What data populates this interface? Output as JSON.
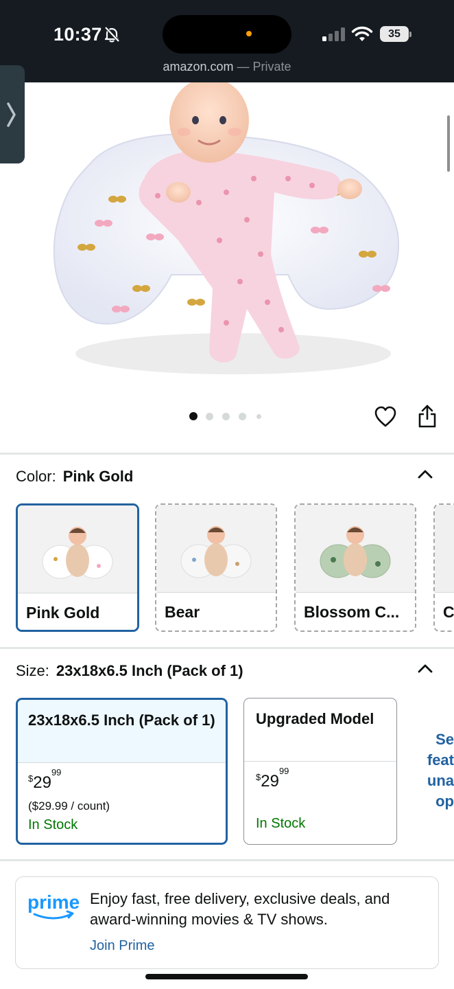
{
  "status_bar": {
    "time": "10:37",
    "battery": "35",
    "url_domain": "amazon.com",
    "url_suffix": " — Private"
  },
  "icons": {
    "bell_muted": "bell-slash-icon",
    "signal": "cellular-signal-icon",
    "wifi": "wifi-icon",
    "heart": "heart-icon",
    "share": "share-icon",
    "chevron": "chevron-up-icon",
    "side_tab": "chevron-right-icon"
  },
  "gallery": {
    "image_alt": "Baby lying on pink gold butterfly nursing pillow",
    "dot_count": 5,
    "active_dot": 0
  },
  "color_selector": {
    "label": "Color:",
    "selected": "Pink Gold",
    "options": [
      {
        "name": "Pink Gold"
      },
      {
        "name": "Bear"
      },
      {
        "name": "Blossom C..."
      },
      {
        "name": "C"
      }
    ]
  },
  "size_selector": {
    "label": "Size:",
    "selected": "23x18x6.5 Inch (Pack of 1)",
    "options": [
      {
        "name": "23x18x6.5 Inch (Pack of 1)",
        "price_symbol": "$",
        "price_whole": "29",
        "price_fraction": "99",
        "per_unit": "($29.99 / count)",
        "stock": "In Stock"
      },
      {
        "name": "Upgraded Model",
        "price_symbol": "$",
        "price_whole": "29",
        "price_fraction": "99",
        "per_unit": "",
        "stock": "In Stock"
      }
    ],
    "see_more": [
      "Se",
      "feat",
      "una",
      "op"
    ]
  },
  "prime": {
    "logo_text": "prime",
    "message": "Enjoy fast, free delivery, exclusive deals, and award-winning movies & TV shows.",
    "link": "Join Prime"
  },
  "colors": {
    "status_bg": "#151b21",
    "accent_blue": "#2162a1",
    "selected_tint": "#edf8ff",
    "in_stock_green": "#007600",
    "prime_blue": "#1a98ff"
  }
}
